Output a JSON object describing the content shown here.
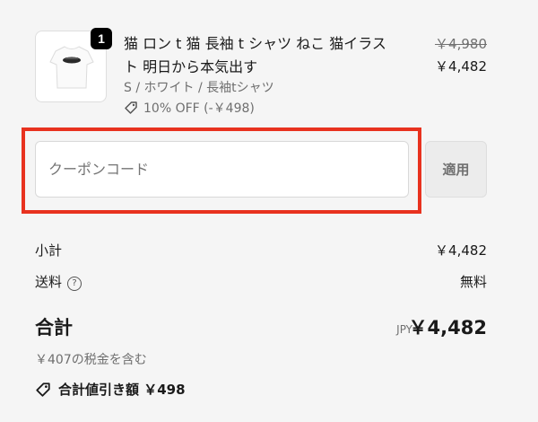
{
  "product": {
    "quantity": "1",
    "title_line1": "猫 ロン t 猫 長袖 t シャツ ねこ 猫イラス",
    "title_line2": "ト 明日から本気出す",
    "variant": "S / ホワイト / 長袖tシャツ",
    "discount": "10% OFF (-￥498)",
    "original_price": "￥4,980",
    "price": "￥4,482",
    "thumbnail_icon": "tshirt-image"
  },
  "coupon": {
    "placeholder": "クーポンコード",
    "value": "",
    "apply_label": "適用",
    "highlight_color": "#e8321f"
  },
  "summary": {
    "subtotal_label": "小計",
    "subtotal_value": "￥4,482",
    "shipping_label": "送料",
    "shipping_help_icon": "question-circle-icon",
    "shipping_value": "無料",
    "total_label": "合計",
    "total_currency": "JPY",
    "total_value": "￥4,482",
    "tax_note": "￥407の税金を含む",
    "savings_label": "合計値引き額 ￥498",
    "tag_icon": "tag-icon"
  }
}
